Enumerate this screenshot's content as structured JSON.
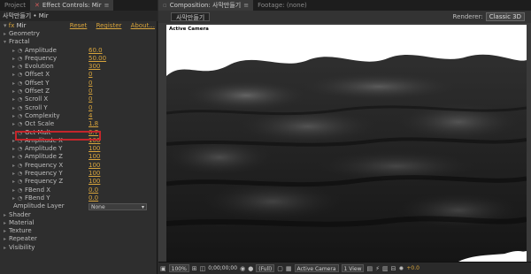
{
  "left_panel": {
    "tabs": [
      {
        "label": "Project",
        "active": false
      },
      {
        "label": "Effect Controls: Mir",
        "active": true
      }
    ],
    "layer_path": "사막만들기 • Mir",
    "effect_name": "Mir",
    "links": {
      "reset": "Reset",
      "register": "Register",
      "about": "About..."
    },
    "rows": [
      {
        "label": "Geometry",
        "indent": 1,
        "twirl": "▸",
        "stopwatch": false,
        "value": ""
      },
      {
        "label": "Fractal",
        "indent": 1,
        "twirl": "▾",
        "stopwatch": false,
        "value": ""
      },
      {
        "label": "Amplitude",
        "indent": 3,
        "twirl": "▸",
        "stopwatch": true,
        "value": "60.0"
      },
      {
        "label": "Frequency",
        "indent": 3,
        "twirl": "▸",
        "stopwatch": true,
        "value": "50.00"
      },
      {
        "label": "Evolution",
        "indent": 3,
        "twirl": "▸",
        "stopwatch": true,
        "value": "300"
      },
      {
        "label": "Offset X",
        "indent": 3,
        "twirl": "▸",
        "stopwatch": true,
        "value": "0"
      },
      {
        "label": "Offset Y",
        "indent": 3,
        "twirl": "▸",
        "stopwatch": true,
        "value": "0"
      },
      {
        "label": "Offset Z",
        "indent": 3,
        "twirl": "▸",
        "stopwatch": true,
        "value": "0"
      },
      {
        "label": "Scroll X",
        "indent": 3,
        "twirl": "▸",
        "stopwatch": true,
        "value": "0"
      },
      {
        "label": "Scroll Y",
        "indent": 3,
        "twirl": "▸",
        "stopwatch": true,
        "value": "0"
      },
      {
        "label": "Complexity",
        "indent": 3,
        "twirl": "▸",
        "stopwatch": true,
        "value": "4"
      },
      {
        "label": "Oct Scale",
        "indent": 3,
        "twirl": "▸",
        "stopwatch": true,
        "value": "1.8"
      },
      {
        "label": "Oct Mult",
        "indent": 3,
        "twirl": "▸",
        "stopwatch": true,
        "value": "0.7"
      },
      {
        "label": "Amplitude X",
        "indent": 3,
        "twirl": "▸",
        "stopwatch": true,
        "value": "100"
      },
      {
        "label": "Amplitude Y",
        "indent": 3,
        "twirl": "▸",
        "stopwatch": true,
        "value": "100"
      },
      {
        "label": "Amplitude Z",
        "indent": 3,
        "twirl": "▸",
        "stopwatch": true,
        "value": "100"
      },
      {
        "label": "Frequency X",
        "indent": 3,
        "twirl": "▸",
        "stopwatch": true,
        "value": "100"
      },
      {
        "label": "Frequency Y",
        "indent": 3,
        "twirl": "▸",
        "stopwatch": true,
        "value": "100"
      },
      {
        "label": "Frequency Z",
        "indent": 3,
        "twirl": "▸",
        "stopwatch": true,
        "value": "100"
      },
      {
        "label": "FBend X",
        "indent": 3,
        "twirl": "▸",
        "stopwatch": true,
        "value": "0.0"
      },
      {
        "label": "FBend Y",
        "indent": 3,
        "twirl": "▸",
        "stopwatch": true,
        "value": "0.0"
      },
      {
        "label": "Amplitude Layer",
        "indent": 2,
        "twirl": "",
        "stopwatch": false,
        "value": "",
        "dropdown": "None"
      },
      {
        "label": "Shader",
        "indent": 1,
        "twirl": "▸",
        "stopwatch": false,
        "value": ""
      },
      {
        "label": "Material",
        "indent": 1,
        "twirl": "▸",
        "stopwatch": false,
        "value": ""
      },
      {
        "label": "Texture",
        "indent": 1,
        "twirl": "▸",
        "stopwatch": false,
        "value": ""
      },
      {
        "label": "Repeater",
        "indent": 1,
        "twirl": "▸",
        "stopwatch": false,
        "value": ""
      },
      {
        "label": "Visibility",
        "indent": 1,
        "twirl": "▸",
        "stopwatch": false,
        "value": ""
      }
    ]
  },
  "right_panel": {
    "tabs": [
      {
        "label": "Composition: 사막만들기",
        "active": true
      },
      {
        "label": "Footage: (none)",
        "active": false
      }
    ],
    "comp_chip": "사막만들기",
    "renderer_label": "Renderer:",
    "renderer_value": "Classic 3D",
    "camera_label": "Active Camera",
    "footer": {
      "zoom": "100%",
      "timecode": "0;00;00;00",
      "resolution": "(Full)",
      "view": "Active Camera",
      "views": "1 View",
      "exposure": "+0.0"
    }
  }
}
